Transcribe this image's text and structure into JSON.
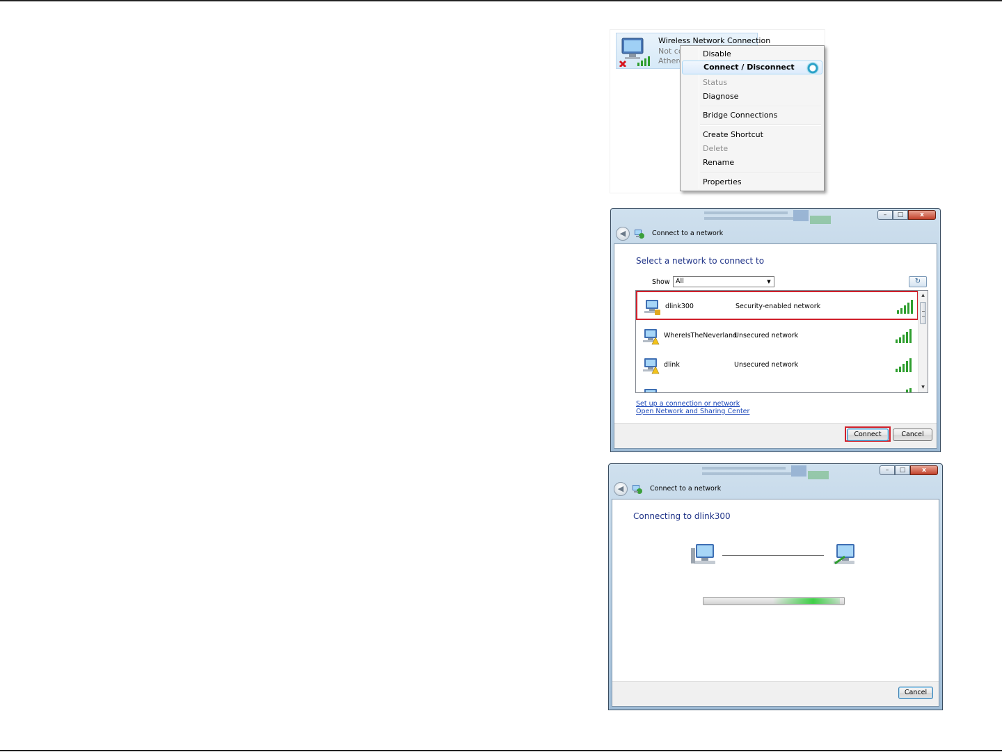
{
  "adapter": {
    "name": "Wireless Network Connection",
    "status": "Not con",
    "device": "Atheros"
  },
  "context_menu": {
    "items": [
      {
        "label": "Disable",
        "state": "normal"
      },
      {
        "label": "Connect / Disconnect",
        "state": "hover"
      },
      {
        "label": "Status",
        "state": "disabled"
      },
      {
        "label": "Diagnose",
        "state": "normal"
      },
      {
        "label": "Bridge Connections",
        "state": "normal"
      },
      {
        "label": "Create Shortcut",
        "state": "normal"
      },
      {
        "label": "Delete",
        "state": "disabled"
      },
      {
        "label": "Rename",
        "state": "normal"
      },
      {
        "label": "Properties",
        "state": "normal"
      }
    ]
  },
  "connect_window": {
    "title": "Connect to a network",
    "heading": "Select a network to connect to",
    "show_label": "Show",
    "show_value": "All",
    "networks": [
      {
        "name": "dlink300",
        "security": "Security-enabled network",
        "signal_bars": 5,
        "selected": true
      },
      {
        "name": "WhereIsTheNeverland",
        "security": "Unsecured network",
        "signal_bars": 5,
        "selected": false
      },
      {
        "name": "dlink",
        "security": "Unsecured network",
        "signal_bars": 5,
        "selected": false
      }
    ],
    "links": [
      "Set up a connection or network",
      "Open Network and Sharing Center"
    ],
    "connect_button": "Connect",
    "cancel_button": "Cancel"
  },
  "connecting_window": {
    "title": "Connect to a network",
    "heading": "Connecting to dlink300",
    "cancel_button": "Cancel"
  },
  "colors": {
    "heading_blue": "#1e3287",
    "highlight_red": "#d0202b",
    "signal_green": "#2f9e2f",
    "link_blue": "#1a46b8"
  }
}
